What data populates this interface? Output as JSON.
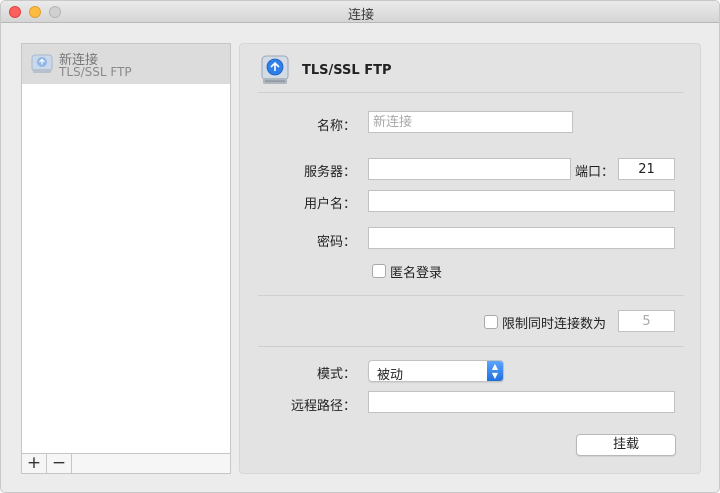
{
  "window": {
    "title": "连接"
  },
  "sidebar": {
    "items": [
      {
        "name": "新连接",
        "protocol": "TLS/SSL FTP",
        "selected": true
      }
    ],
    "add_label": "+",
    "remove_label": "−"
  },
  "panel": {
    "protocol_title": "TLS/SSL FTP",
    "name_label": "名称：",
    "name_placeholder": "新连接",
    "name_value": "",
    "server_label": "服务器：",
    "server_value": "",
    "port_label": "端口：",
    "port_value": "21",
    "username_label": "用户名：",
    "username_value": "",
    "password_label": "密码：",
    "password_value": "",
    "anonymous_label": "匿名登录",
    "anonymous_checked": false,
    "limit_label": "限制同时连接数为",
    "limit_checked": false,
    "limit_value": "5",
    "mode_label": "模式：",
    "mode_value": "被动",
    "remote_path_label": "远程路径：",
    "remote_path_value": "",
    "mount_button": "挂载"
  },
  "colors": {
    "accent": "#1f6fe0",
    "selected_row": "#dcdcdc"
  },
  "icons": {
    "connection": "ftp-drive-icon",
    "panel": "ftp-drive-icon"
  }
}
